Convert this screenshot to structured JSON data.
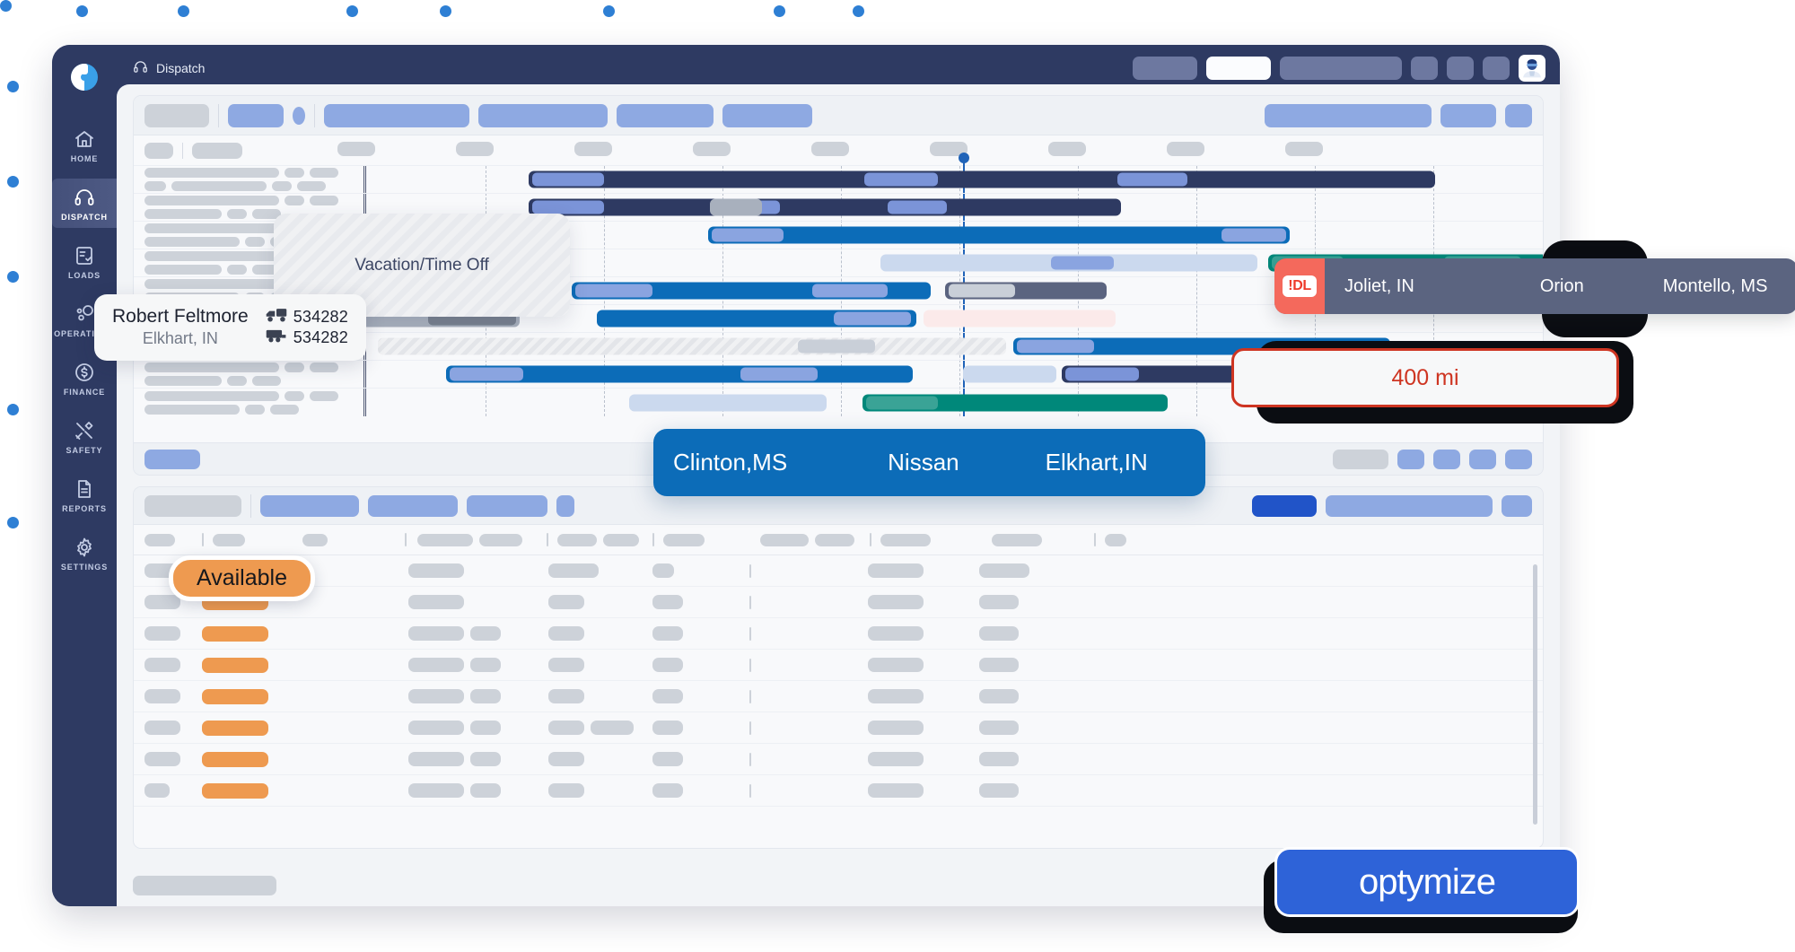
{
  "app": {
    "brand_logo_name": "optymize-logo-mark",
    "window_bg": "#2e3a62"
  },
  "topbar": {
    "page_title": "Dispatch",
    "title_icon": "headset-icon",
    "avatar_name": "user-avatar"
  },
  "sidebar": {
    "items": [
      {
        "label": "HOME",
        "icon": "home-icon",
        "active": false
      },
      {
        "label": "DISPATCH",
        "icon": "headset-icon",
        "active": true
      },
      {
        "label": "LOADS",
        "icon": "clipboard-check-icon",
        "active": false
      },
      {
        "label": "OPERATIONS",
        "icon": "network-nodes-icon",
        "active": false
      },
      {
        "label": "FINANCE",
        "icon": "dollar-circle-icon",
        "active": false
      },
      {
        "label": "SAFETY",
        "icon": "tools-icon",
        "active": false
      },
      {
        "label": "REPORTS",
        "icon": "document-icon",
        "active": false
      },
      {
        "label": "SETTINGS",
        "icon": "gear-icon",
        "active": false
      }
    ]
  },
  "callouts": {
    "driver": {
      "name": "Robert Feltmore",
      "location": "Elkhart, IN",
      "tractor_icon": "tractor-icon",
      "tractor_unit": "534282",
      "trailer_icon": "trailer-icon",
      "trailer_unit": "534282"
    },
    "vacation": {
      "label": "Vacation/Time Off"
    },
    "driver_log": {
      "badge": "!DL",
      "origin": "Joliet, IN",
      "middle": "Orion",
      "destination": "Montello, MS"
    },
    "distance": {
      "value": "400 mi",
      "accent": "#ce3522"
    },
    "route": {
      "origin": "Clinton,MS",
      "middle": "Nissan",
      "destination": "Elkhart,IN",
      "accent": "#0c6cb8"
    },
    "status_badge": {
      "label": "Available",
      "accent": "#ee9a50"
    },
    "brand": {
      "wordmark": "optymize",
      "accent": "#2e63d8"
    }
  },
  "colors": {
    "navy": "#2e3a62",
    "blue": "#0c6cb8",
    "teal": "#00887a",
    "orange": "#ee9a50",
    "red": "#f2573d",
    "lavender": "#8ea9e2"
  }
}
